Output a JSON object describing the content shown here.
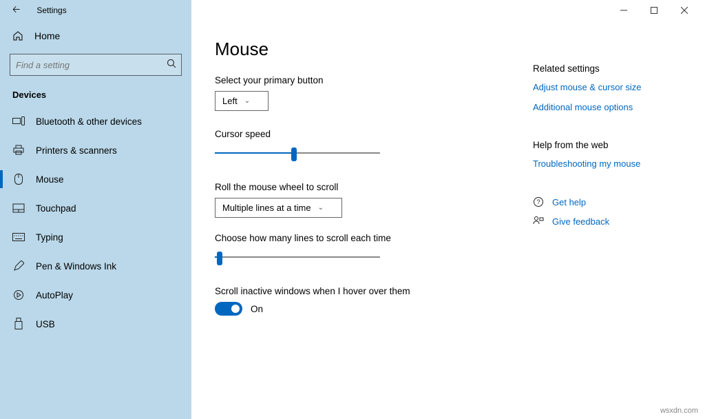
{
  "window": {
    "title": "Settings",
    "watermark": "wsxdn.com"
  },
  "sidebar": {
    "home": "Home",
    "search_placeholder": "Find a setting",
    "section": "Devices",
    "items": [
      {
        "label": "Bluetooth & other devices"
      },
      {
        "label": "Printers & scanners"
      },
      {
        "label": "Mouse"
      },
      {
        "label": "Touchpad"
      },
      {
        "label": "Typing"
      },
      {
        "label": "Pen & Windows Ink"
      },
      {
        "label": "AutoPlay"
      },
      {
        "label": "USB"
      }
    ]
  },
  "main": {
    "heading": "Mouse",
    "primary_button_label": "Select your primary button",
    "primary_button_value": "Left",
    "cursor_speed_label": "Cursor speed",
    "cursor_speed_value": 48,
    "wheel_label": "Roll the mouse wheel to scroll",
    "wheel_value": "Multiple lines at a time",
    "lines_label": "Choose how many lines to scroll each time",
    "lines_value": 3,
    "inactive_label": "Scroll inactive windows when I hover over them",
    "inactive_state": "On"
  },
  "right": {
    "related_heading": "Related settings",
    "related_links": [
      "Adjust mouse & cursor size",
      "Additional mouse options"
    ],
    "help_heading": "Help from the web",
    "help_links": [
      "Troubleshooting my mouse"
    ],
    "get_help": "Get help",
    "give_feedback": "Give feedback"
  }
}
